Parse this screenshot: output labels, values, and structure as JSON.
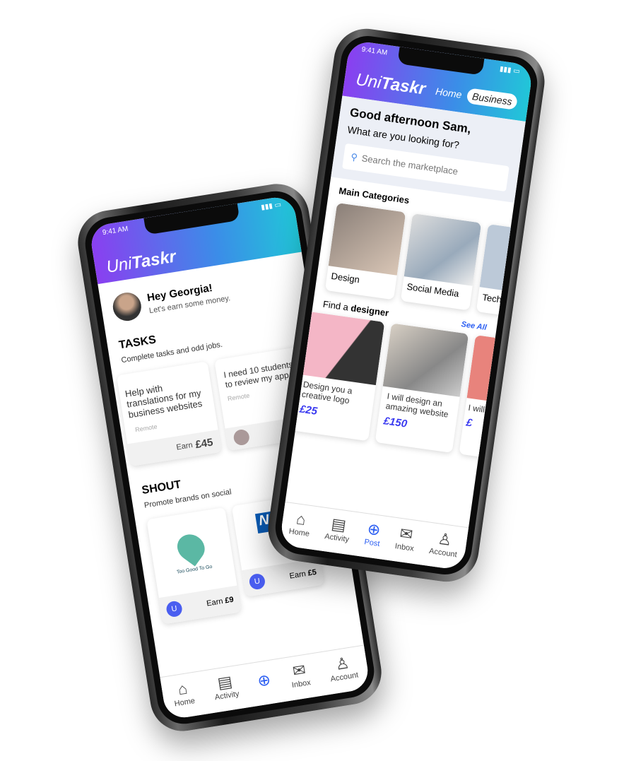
{
  "left_phone": {
    "time": "9:41 AM",
    "logo_uni": "Uni",
    "logo_taskr": "Taskr",
    "greeting": "Hey Georgia!",
    "subgreeting": "Let's earn some money.",
    "tasks_title": "TASKS",
    "tasks_subtitle": "Complete tasks and odd jobs.",
    "tasks": [
      {
        "title": "Help with translations for my business websites",
        "location": "Remote",
        "earn_label": "Earn",
        "amount": "£45"
      },
      {
        "title": "I need 10 students to review my app",
        "location": "Remote"
      }
    ],
    "shout_title": "SHOUT",
    "shout_subtitle": "Promote brands on social",
    "shouts": [
      {
        "brand": "Too Good To Go",
        "earn_label": "Earn",
        "amount": "£9"
      },
      {
        "brand": "NHS",
        "earn_label": "Earn",
        "amount": "£5"
      }
    ],
    "nav": [
      "Home",
      "Activity",
      "Post",
      "Inbox",
      "Account"
    ]
  },
  "right_phone": {
    "time": "9:41 AM",
    "logo_uni": "Uni",
    "logo_taskr": "Taskr",
    "tab_home": "Home",
    "tab_business": "Business",
    "greeting": "Good afternoon Sam,",
    "question": "What are you looking for?",
    "search_placeholder": "Search the marketplace",
    "categories_title": "Main Categories",
    "categories": [
      "Design",
      "Social Media",
      "Tech"
    ],
    "find_prefix": "Find a",
    "find_bold": "designer",
    "see_all": "See All",
    "services": [
      {
        "title": "Design you a creative logo",
        "price": "£25"
      },
      {
        "title": "I will design an amazing website",
        "price": "£150"
      },
      {
        "title": "I will ... an ...",
        "price": "£"
      }
    ],
    "nav": [
      "Home",
      "Activity",
      "Post",
      "Inbox",
      "Account"
    ],
    "accent": "#2b5ef2"
  }
}
